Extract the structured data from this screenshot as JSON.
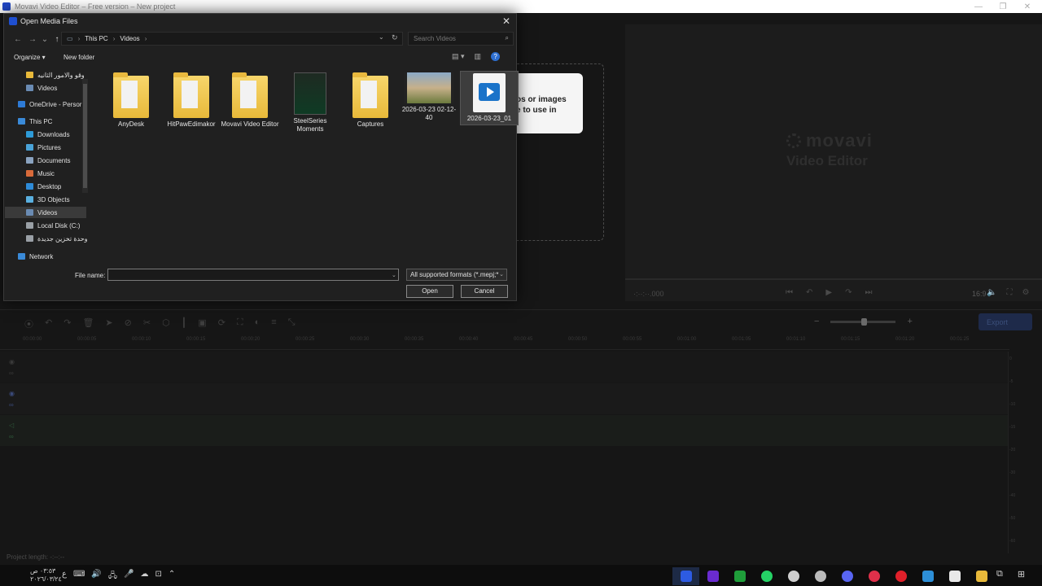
{
  "window": {
    "title": "Movavi Video Editor – Free version – New project",
    "minimize": "—",
    "restore": "❐",
    "close": "✕"
  },
  "preview": {
    "logo_line1": "movavi",
    "logo_line2": "Video Editor",
    "timecode": "·:··:··.000",
    "controls": [
      "⏮",
      "↶",
      "▶",
      "↷",
      "⏭"
    ],
    "aspect": "16:9",
    "right_controls": [
      "🔈",
      "⛶",
      "⚙"
    ]
  },
  "dropzone": {
    "text_line1": "os or images",
    "text_line2": "e to use in"
  },
  "timeline": {
    "tools": [
      "⦿",
      "↶",
      "↷",
      "🗑",
      "➤",
      "⊘",
      "✂",
      "⬡",
      "┃",
      "▣",
      "⟳",
      "⛶",
      "◐",
      "≡",
      "⤡"
    ],
    "zoom_minus": "−",
    "zoom_plus": "+",
    "export": "Export",
    "ruler": [
      "00:00:00",
      "00:00:05",
      "00:00:10",
      "00:00:15",
      "00:00:20",
      "00:00:25",
      "00:00:30",
      "00:00:35",
      "00:00:40",
      "00:00:45",
      "00:00:50",
      "00:00:55",
      "00:01:00",
      "00:01:05",
      "00:01:10",
      "00:01:15",
      "00:01:20",
      "00:01:25"
    ],
    "db_scale": [
      "0",
      "-5",
      "-10",
      "-15",
      "-20",
      "-30",
      "-40",
      "-50",
      "-60"
    ],
    "project_length": "Project length: -:--:--"
  },
  "dialog": {
    "title": "Open Media Files",
    "close": "✕",
    "nav": [
      "←",
      "→",
      "⌄",
      "↑"
    ],
    "breadcrumb": [
      "This PC",
      "Videos"
    ],
    "search_placeholder": "Search Videos",
    "organize": "Organize ▾",
    "new_folder": "New folder",
    "help": "?",
    "nav_items": [
      {
        "label": "وقو والامور الثانيه",
        "icon": "folder-icon",
        "color": "#e8b93a"
      },
      {
        "label": "Videos",
        "icon": "videos-icon",
        "color": "#6a8bb3"
      },
      {
        "label": "OneDrive - Persor",
        "icon": "onedrive-icon",
        "color": "#2e7bd6"
      },
      {
        "label": "This PC",
        "icon": "pc-icon",
        "color": "#3a8ad8"
      },
      {
        "label": "Downloads",
        "icon": "downloads-icon",
        "color": "#2e9bd8"
      },
      {
        "label": "Pictures",
        "icon": "pictures-icon",
        "color": "#4aa3d8"
      },
      {
        "label": "Documents",
        "icon": "documents-icon",
        "color": "#8aa3c0"
      },
      {
        "label": "Music",
        "icon": "music-icon",
        "color": "#d86a3a"
      },
      {
        "label": "Desktop",
        "icon": "desktop-icon",
        "color": "#2e8bd8"
      },
      {
        "label": "3D Objects",
        "icon": "3d-objects-icon",
        "color": "#5ab0e0"
      },
      {
        "label": "Videos",
        "icon": "videos-icon",
        "color": "#6a8bb3"
      },
      {
        "label": "Local Disk (C:)",
        "icon": "disk-icon",
        "color": "#9aa0a6"
      },
      {
        "label": "وحدة تخزين جديدة",
        "icon": "drive-icon",
        "color": "#9aa0a6"
      },
      {
        "label": "Network",
        "icon": "network-icon",
        "color": "#3a8ad8"
      }
    ],
    "files": [
      {
        "name": "AnyDesk",
        "kind": "folder"
      },
      {
        "name": "HitPawEdimakor",
        "kind": "folder"
      },
      {
        "name": "Movavi Video Editor",
        "kind": "folder"
      },
      {
        "name": "SteelSeries Moments",
        "kind": "game-folder"
      },
      {
        "name": "Captures",
        "kind": "folder"
      },
      {
        "name": "2026-03-23 02-12-40",
        "kind": "video"
      },
      {
        "name": "2026-03-23_01",
        "kind": "media"
      }
    ],
    "file_name_label": "File name:",
    "file_name_value": "",
    "filter": "All supported formats (*.mepj;*",
    "open": "Open",
    "cancel": "Cancel"
  },
  "taskbar": {
    "clock_time": "٠٣:٥٣ ص",
    "clock_date": "٢٠٢٦/٠٣/٢٤",
    "lang": "ع",
    "tray": [
      "⌨",
      "🔊",
      "🖧",
      "🎤",
      "☁",
      "⊡",
      "⌃"
    ],
    "apps": [
      {
        "name": "movavi",
        "color": "#2d5be3"
      },
      {
        "name": "purple-app",
        "color": "#6a2bd0"
      },
      {
        "name": "xbox",
        "color": "#1f9e3a"
      },
      {
        "name": "whatsapp",
        "color": "#25d366"
      },
      {
        "name": "steam",
        "color": "#cfcfcf"
      },
      {
        "name": "speed",
        "color": "#bbbbbb"
      },
      {
        "name": "discord",
        "color": "#5865f2"
      },
      {
        "name": "opera-gx",
        "color": "#e0304a"
      },
      {
        "name": "opera",
        "color": "#e0202a"
      },
      {
        "name": "mail",
        "color": "#2d8fd8"
      },
      {
        "name": "store",
        "color": "#e8e8e8"
      },
      {
        "name": "explorer",
        "color": "#e8b93a"
      }
    ],
    "right": [
      "⧉",
      "⊞"
    ]
  }
}
